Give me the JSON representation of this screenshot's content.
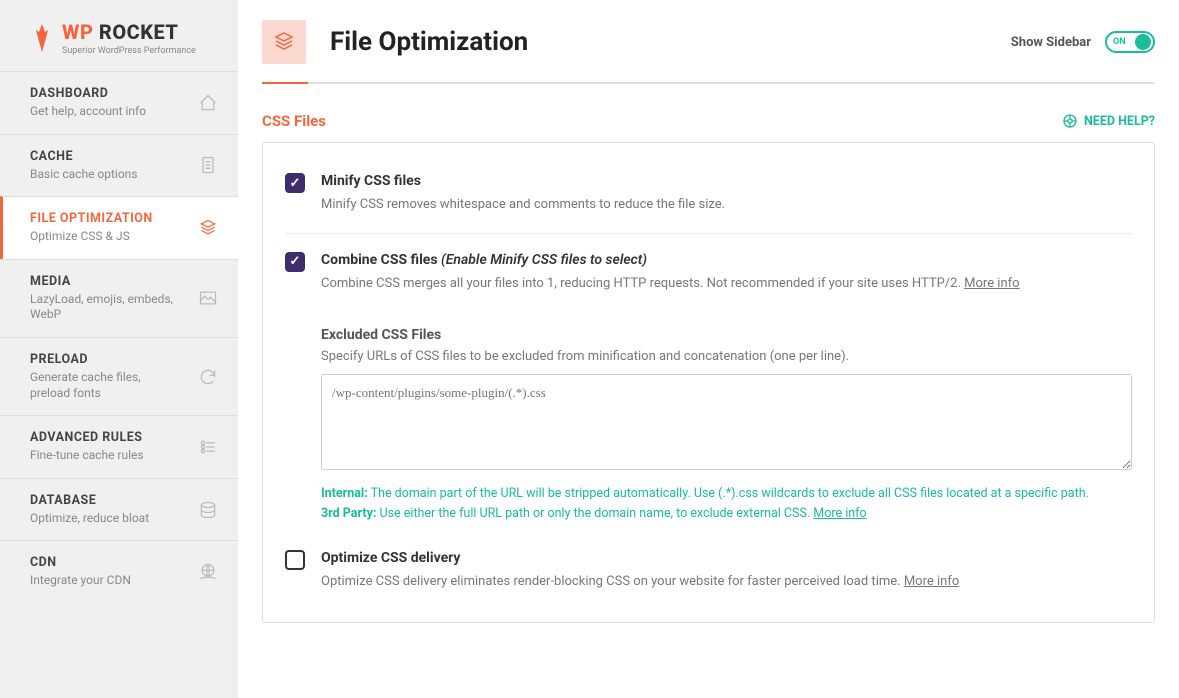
{
  "logo": {
    "brand1": "WP",
    "brand2": " ROCKET",
    "tagline": "Superior WordPress Performance"
  },
  "sidebar": {
    "items": [
      {
        "title": "DASHBOARD",
        "desc": "Get help, account info"
      },
      {
        "title": "CACHE",
        "desc": "Basic cache options"
      },
      {
        "title": "FILE OPTIMIZATION",
        "desc": "Optimize CSS & JS"
      },
      {
        "title": "MEDIA",
        "desc": "LazyLoad, emojis, embeds, WebP"
      },
      {
        "title": "PRELOAD",
        "desc": "Generate cache files, preload fonts"
      },
      {
        "title": "ADVANCED RULES",
        "desc": "Fine-tune cache rules"
      },
      {
        "title": "DATABASE",
        "desc": "Optimize, reduce bloat"
      },
      {
        "title": "CDN",
        "desc": "Integrate your CDN"
      }
    ]
  },
  "header": {
    "title": "File Optimization",
    "show_sidebar": "Show Sidebar",
    "toggle": "ON"
  },
  "section": {
    "title": "CSS Files",
    "help": "NEED HELP?"
  },
  "options": {
    "minify": {
      "title": "Minify CSS files",
      "desc": "Minify CSS removes whitespace and comments to reduce the file size."
    },
    "combine": {
      "title": "Combine CSS files ",
      "hint": "(Enable Minify CSS files to select)",
      "desc": "Combine CSS merges all your files into 1, reducing HTTP requests. Not recommended if your site uses HTTP/2. ",
      "more": "More info"
    },
    "excluded": {
      "title": "Excluded CSS Files",
      "desc": "Specify URLs of CSS files to be excluded from minification and concatenation (one per line).",
      "placeholder": "/wp-content/plugins/some-plugin/(.*).css",
      "note_internal_label": "Internal:",
      "note_internal": " The domain part of the URL will be stripped automatically. Use (.*).css wildcards to exclude all CSS files located at a specific path.",
      "note_3rd_label": "3rd Party:",
      "note_3rd": " Use either the full URL path or only the domain name, to exclude external CSS. ",
      "note_more": "More info"
    },
    "optimize": {
      "title": "Optimize CSS delivery",
      "desc": "Optimize CSS delivery eliminates render-blocking CSS on your website for faster perceived load time. ",
      "more": "More info"
    }
  }
}
